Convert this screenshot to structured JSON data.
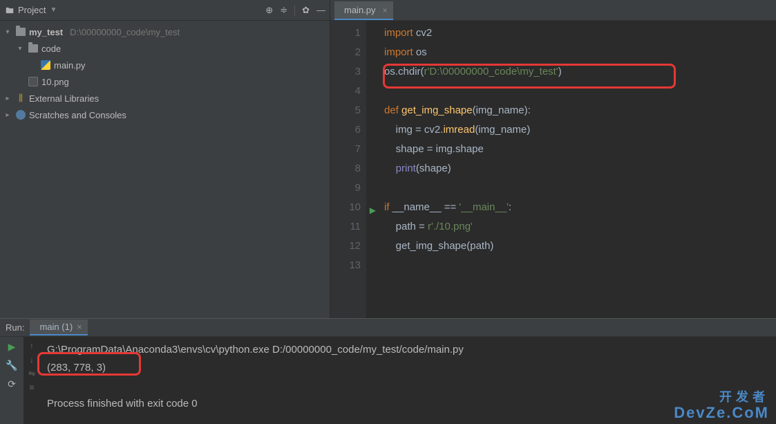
{
  "sidebar": {
    "title": "Project",
    "tree": {
      "root": {
        "name": "my_test",
        "path": "D:\\00000000_code\\my_test"
      },
      "code": "code",
      "main": "main.py",
      "png": "10.png",
      "libs": "External Libraries",
      "scratches": "Scratches and Consoles"
    }
  },
  "editor": {
    "tab": "main.py",
    "lines": [
      {
        "n": "1",
        "seg": [
          {
            "c": "kw",
            "t": "import "
          },
          {
            "c": "id",
            "t": "cv2"
          }
        ]
      },
      {
        "n": "2",
        "seg": [
          {
            "c": "kw",
            "t": "import "
          },
          {
            "c": "id",
            "t": "os"
          }
        ]
      },
      {
        "n": "3",
        "seg": [
          {
            "c": "id",
            "t": "os.chdir("
          },
          {
            "c": "str",
            "t": "r'D:\\00000000_code\\my_test'"
          },
          {
            "c": "id",
            "t": ")"
          }
        ]
      },
      {
        "n": "4",
        "seg": []
      },
      {
        "n": "5",
        "seg": [
          {
            "c": "kw",
            "t": "def "
          },
          {
            "c": "fn",
            "t": "get_img_shape"
          },
          {
            "c": "id",
            "t": "(img_name):"
          }
        ]
      },
      {
        "n": "6",
        "seg": [
          {
            "c": "id",
            "t": "    img = cv2."
          },
          {
            "c": "fn",
            "t": "imread"
          },
          {
            "c": "id",
            "t": "(img_name)"
          }
        ]
      },
      {
        "n": "7",
        "seg": [
          {
            "c": "id",
            "t": "    shape = img.shape"
          }
        ]
      },
      {
        "n": "8",
        "seg": [
          {
            "c": "id",
            "t": "    "
          },
          {
            "c": "bi",
            "t": "print"
          },
          {
            "c": "id",
            "t": "(shape)"
          }
        ]
      },
      {
        "n": "9",
        "seg": []
      },
      {
        "n": "10",
        "seg": [
          {
            "c": "kw",
            "t": "if "
          },
          {
            "c": "id",
            "t": "__name__ == "
          },
          {
            "c": "str",
            "t": "'__main__'"
          },
          {
            "c": "id",
            "t": ":"
          }
        ]
      },
      {
        "n": "11",
        "seg": [
          {
            "c": "id",
            "t": "    path = "
          },
          {
            "c": "str",
            "t": "r'./10.png'"
          }
        ]
      },
      {
        "n": "12",
        "seg": [
          {
            "c": "id",
            "t": "    get_img_shape(path)"
          }
        ]
      },
      {
        "n": "13",
        "seg": []
      }
    ]
  },
  "run": {
    "title": "Run:",
    "tab": "main (1)",
    "lines": [
      "G:\\ProgramData\\Anaconda3\\envs\\cv\\python.exe D:/00000000_code/my_test/code/main.py",
      "(283, 778, 3)",
      "",
      "Process finished with exit code 0"
    ]
  },
  "watermark": {
    "cn": "开发者",
    "en": "DevZe.CoM"
  }
}
